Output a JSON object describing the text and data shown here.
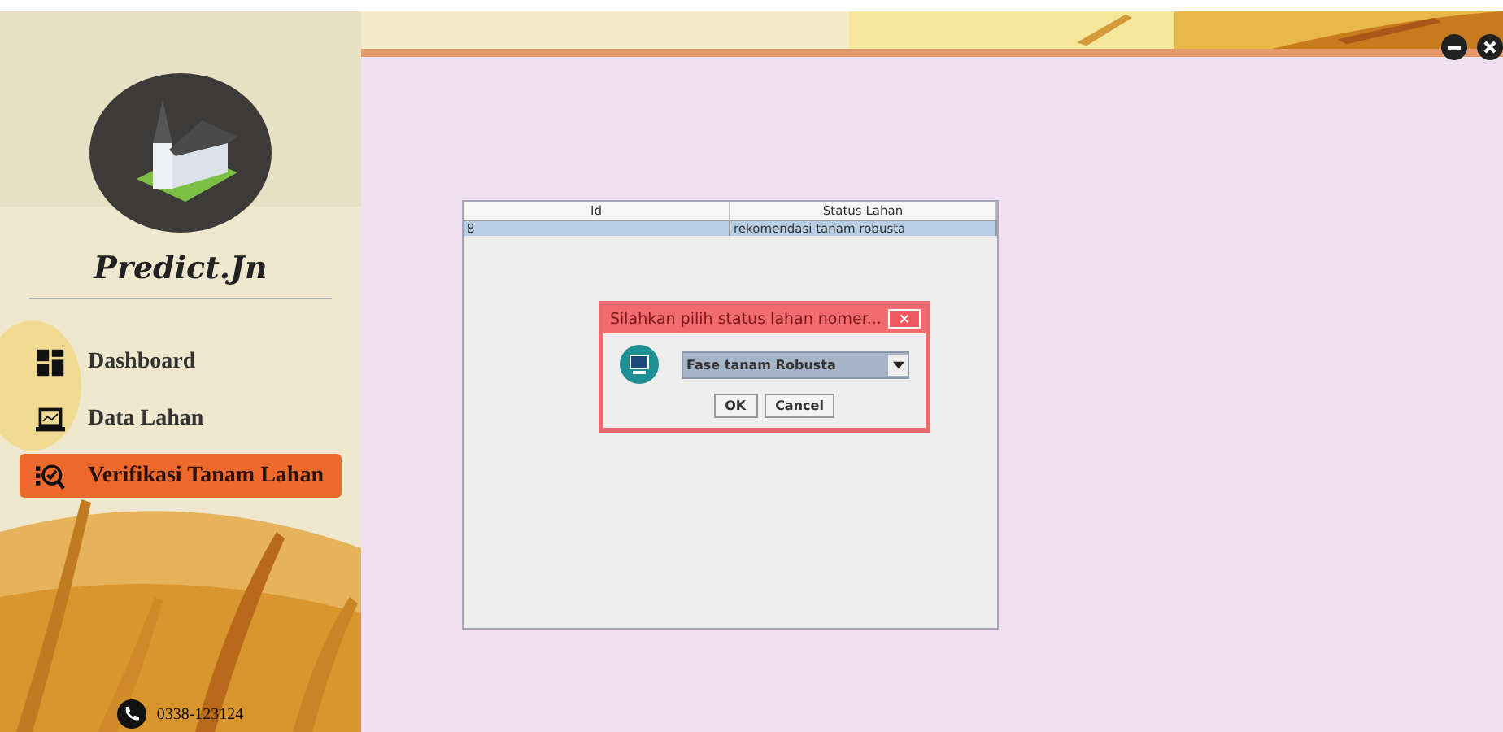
{
  "sidebar": {
    "logo_text": "Predict.Jn",
    "items": [
      {
        "kind": "dashboard",
        "label": "Dashboard",
        "selected": false
      },
      {
        "kind": "data",
        "label": "Data Lahan",
        "selected": false
      },
      {
        "kind": "verify",
        "label": "Verifikasi Tanam Lahan",
        "selected": true
      }
    ],
    "phone": "0338-123124"
  },
  "table": {
    "columns": [
      "Id",
      "Status Lahan"
    ],
    "rows": [
      {
        "cells": [
          "8",
          "rekomendasi tanam robusta"
        ],
        "selected": true
      }
    ]
  },
  "dialog": {
    "title": "Silahkan pilih status lahan nomer...",
    "select_value": "Fase tanam Robusta",
    "buttons": [
      "OK",
      "Cancel"
    ]
  }
}
